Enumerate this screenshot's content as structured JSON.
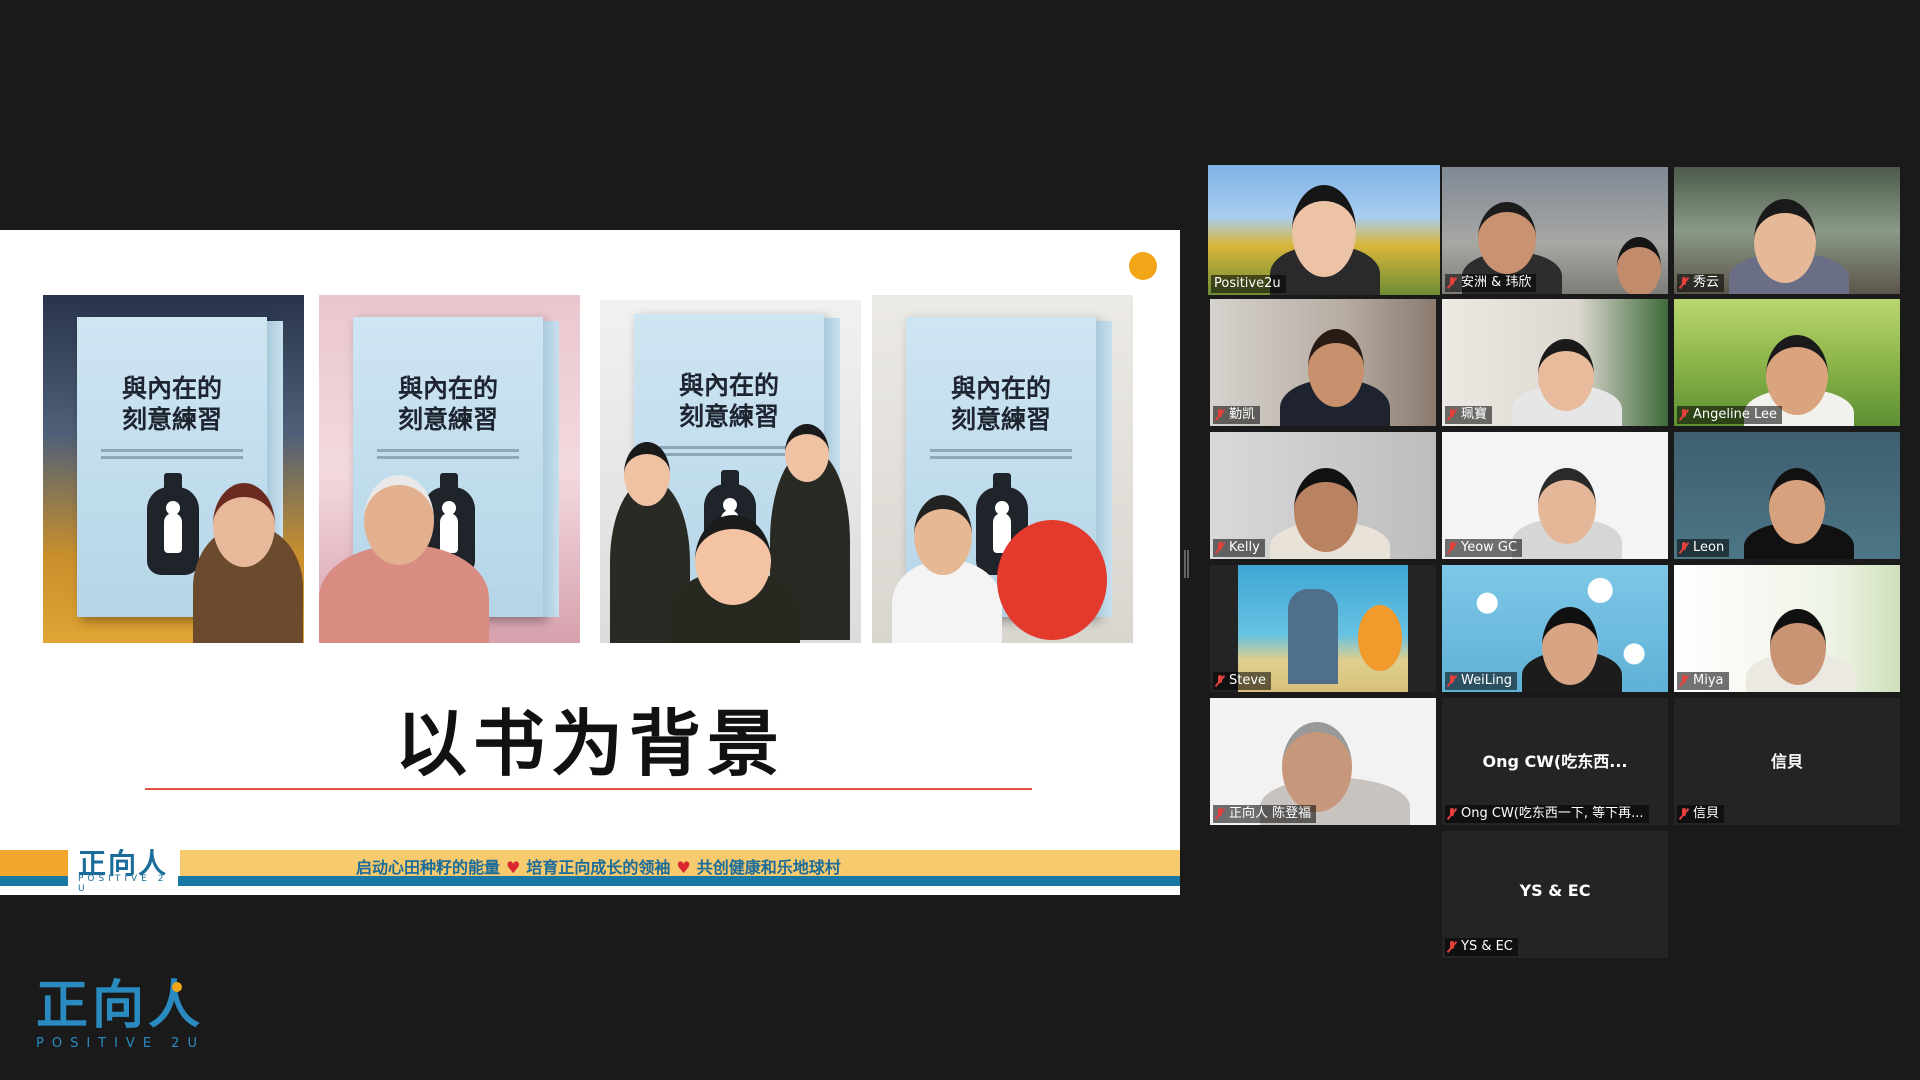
{
  "colors": {
    "app_bg": "#1a1a1a",
    "active_speaker_border": "#d8e85b",
    "accent_orange": "#f2a516",
    "brand_blue": "#1878a3",
    "mic_muted_red": "#e5403b"
  },
  "slide": {
    "book_title_lines": "與內在的\n刻意練習",
    "title": "以书为背景",
    "footer": {
      "logo_cn": "正向人",
      "logo_en": "POSITIVE 2 U",
      "slogan_1": "启动心田种籽的能量",
      "slogan_2": "培育正向成长的领袖",
      "slogan_3": "共创健康和乐地球村",
      "heart": "♥"
    }
  },
  "gallery": {
    "participants": [
      {
        "name": "Positive2u",
        "muted": false,
        "active": true
      },
      {
        "name": "安洲 & 玮欣",
        "muted": true
      },
      {
        "name": "秀云",
        "muted": true
      },
      {
        "name": "勤凯",
        "muted": true
      },
      {
        "name": "珮寶",
        "muted": true
      },
      {
        "name": "Angeline Lee",
        "muted": true
      },
      {
        "name": "Kelly",
        "muted": true
      },
      {
        "name": "Yeow GC",
        "muted": true
      },
      {
        "name": "Leon",
        "muted": true
      },
      {
        "name": "Steve",
        "muted": true
      },
      {
        "name": "WeiLing",
        "muted": true
      },
      {
        "name": "Miya",
        "muted": true
      },
      {
        "name": "正向人 陈登福",
        "muted": true
      },
      {
        "name": "Ong CW(吃东西一下, 等下再...",
        "display": "Ong CW(吃东西...",
        "muted": true,
        "video_off": true
      },
      {
        "name": "信貝",
        "display": "信貝",
        "muted": true,
        "video_off": true
      },
      {
        "name": "YS & EC",
        "display": "YS & EC",
        "muted": true,
        "video_off": true
      }
    ]
  },
  "corner_logo": {
    "cn": "正向人",
    "en": "POSITIVE 2U"
  }
}
